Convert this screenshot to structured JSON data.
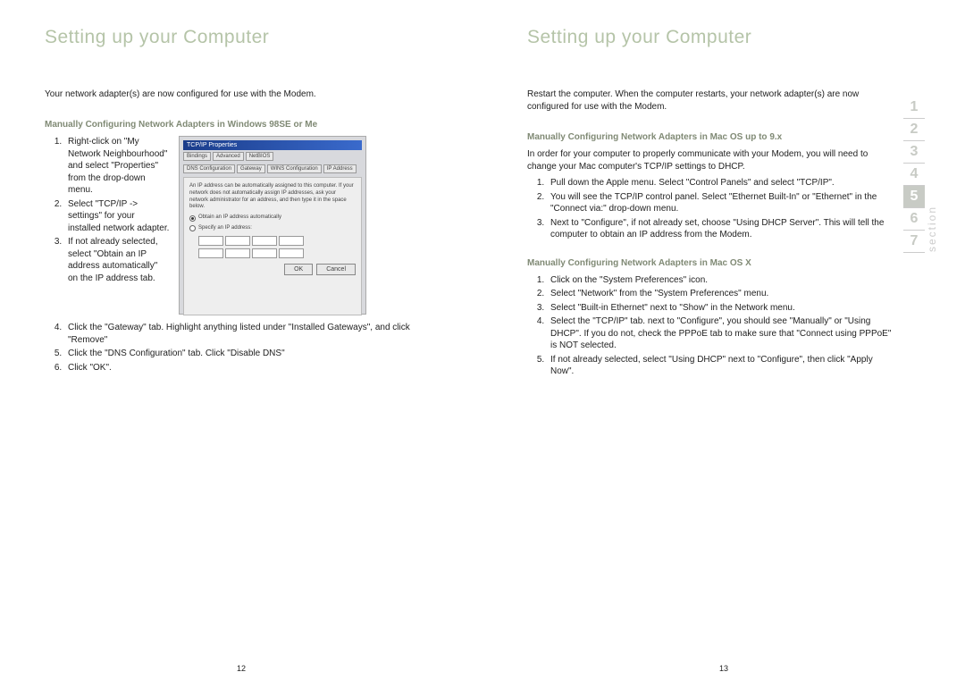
{
  "leftPage": {
    "heading": "Setting up your Computer",
    "intro": "Your network adapter(s) are now configured for use with the Modem.",
    "section1": {
      "title": "Manually Configuring Network Adapters in Windows 98SE or Me",
      "steps_a": [
        "Right-click on \"My Network Neighbourhood\" and select \"Properties\" from the drop-down menu.",
        "Select \"TCP/IP -> settings\" for your installed network adapter.",
        "If not already selected, select \"Obtain an IP address automatically\" on the IP address tab."
      ],
      "steps_b": [
        "Click the \"Gateway\" tab. Highlight anything listed under \"Installed Gateways\", and click \"Remove\"",
        "Click the \"DNS Configuration\" tab. Click \"Disable DNS\"",
        "Click \"OK\"."
      ]
    },
    "screenshot": {
      "title": "TCP/IP Properties",
      "tabs": [
        "Bindings",
        "Advanced",
        "NetBIOS"
      ],
      "tabs2": [
        "DNS Configuration",
        "Gateway",
        "WINS Configuration",
        "IP Address"
      ],
      "body_text": "An IP address can be automatically assigned to this computer. If your network does not automatically assign IP addresses, ask your network administrator for an address, and then type it in the space below.",
      "radio1": "Obtain an IP address automatically",
      "radio2": "Specify an IP address:",
      "btn_ok": "OK",
      "btn_cancel": "Cancel"
    },
    "pageNumber": "12"
  },
  "rightPage": {
    "heading": "Setting up your Computer",
    "intro": "Restart the computer. When the computer restarts, your network adapter(s) are now configured for use with the Modem.",
    "section1": {
      "title": "Manually Configuring Network Adapters in Mac OS up to 9.x",
      "intro": "In order for your computer to properly communicate with your Modem, you will need to change your Mac computer's TCP/IP settings to DHCP.",
      "steps": [
        "Pull down the Apple menu. Select \"Control Panels\" and select \"TCP/IP\".",
        "You will see the TCP/IP control panel. Select \"Ethernet Built-In\" or \"Ethernet\" in the \"Connect via:\" drop-down menu.",
        "Next to \"Configure\", if not already set, choose \"Using DHCP Server\". This will tell the computer to obtain an IP address from the Modem."
      ]
    },
    "section2": {
      "title": "Manually Configuring Network Adapters in Mac OS X",
      "steps": [
        "Click on the \"System Preferences\" icon.",
        "Select \"Network\" from the \"System Preferences\" menu.",
        "Select \"Built-in Ethernet\" next to \"Show\" in the Network menu.",
        "Select the \"TCP/IP\" tab. next to \"Configure\", you should see \"Manually\" or \"Using DHCP\". If you do not, check the PPPoE tab to make sure that \"Connect using PPPoE\" is NOT selected.",
        "If not already selected, select \"Using DHCP\" next to \"Configure\", then click \"Apply Now\"."
      ]
    },
    "pageNumber": "13"
  },
  "sectionNav": {
    "label": "section",
    "items": [
      "1",
      "2",
      "3",
      "4",
      "5",
      "6",
      "7"
    ],
    "active": "5"
  }
}
